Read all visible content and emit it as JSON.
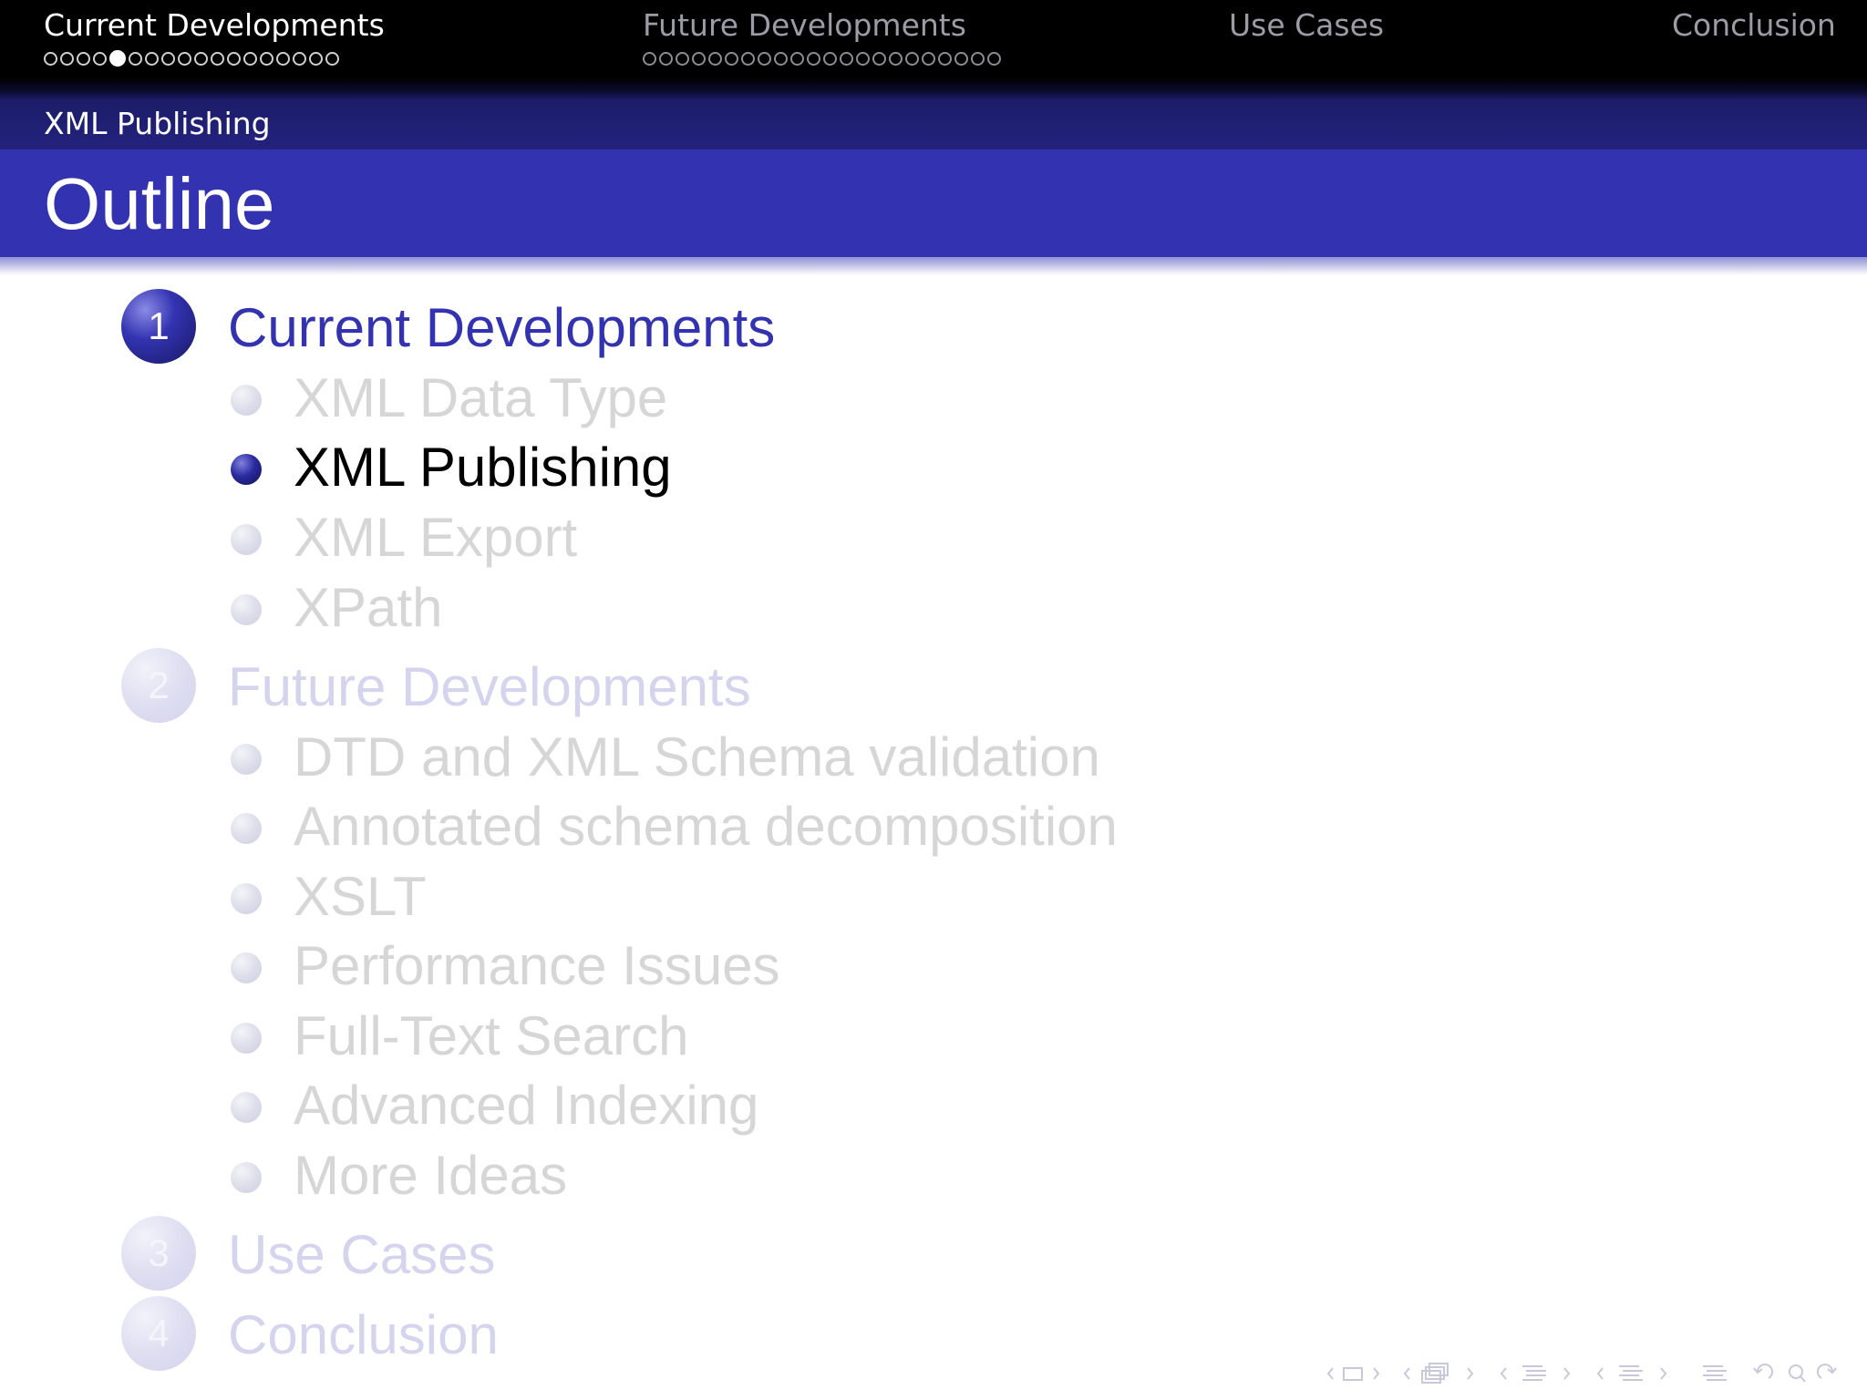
{
  "top_nav": {
    "sections": [
      {
        "label": "Current Developments",
        "current": true,
        "dots_before": 4,
        "dots_after": 13
      },
      {
        "label": "Future Developments",
        "current": false,
        "dots_before": 0,
        "dots_after": 22
      },
      {
        "label": "Use Cases",
        "current": false,
        "dots_before": 0,
        "dots_after": 0
      },
      {
        "label": "Conclusion",
        "current": false,
        "dots_before": 0,
        "dots_after": 0
      }
    ]
  },
  "subsection_header": "XML Publishing",
  "frame_title": "Outline",
  "outline": {
    "sections": [
      {
        "number": "1",
        "label": "Current Developments",
        "active": true,
        "items": [
          {
            "label": "XML Data Type",
            "active": false
          },
          {
            "label": "XML Publishing",
            "active": true
          },
          {
            "label": "XML Export",
            "active": false
          },
          {
            "label": "XPath",
            "active": false
          }
        ]
      },
      {
        "number": "2",
        "label": "Future Developments",
        "active": false,
        "items": [
          {
            "label": "DTD and XML Schema validation",
            "active": false
          },
          {
            "label": "Annotated schema decomposition",
            "active": false
          },
          {
            "label": "XSLT",
            "active": false
          },
          {
            "label": "Performance Issues",
            "active": false
          },
          {
            "label": "Full-Text Search",
            "active": false
          },
          {
            "label": "Advanced Indexing",
            "active": false
          },
          {
            "label": "More Ideas",
            "active": false
          }
        ]
      },
      {
        "number": "3",
        "label": "Use Cases",
        "active": false,
        "items": []
      },
      {
        "number": "4",
        "label": "Conclusion",
        "active": false,
        "items": []
      }
    ]
  },
  "nav_symbols": [
    "slide-nav-icon",
    "frame-nav-icon",
    "subsection-nav-icon",
    "section-nav-icon",
    "document-nav-icon",
    "back-forward-search-icon"
  ],
  "colors": {
    "theme_blue": "#3333b2",
    "nav_black": "#000000",
    "dim_section": "#d4d4ee",
    "dim_item": "#d6d6d6"
  }
}
